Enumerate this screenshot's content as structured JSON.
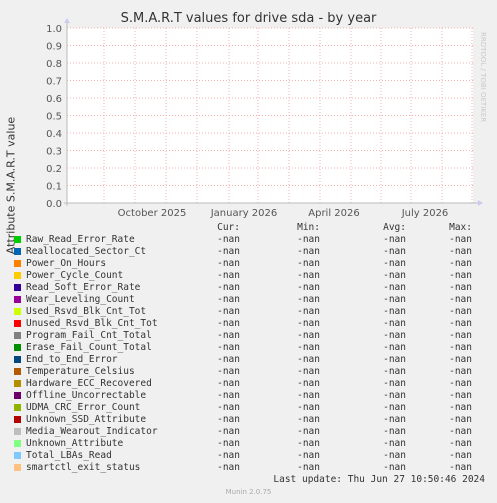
{
  "chart_data": {
    "type": "line",
    "title": "S.M.A.R.T values for drive sda - by year",
    "ylabel": "Attribute S.M.A.R.T value",
    "ylim": [
      0,
      1
    ],
    "yticks": [
      "0.0",
      "0.1",
      "0.2",
      "0.3",
      "0.4",
      "0.5",
      "0.6",
      "0.7",
      "0.8",
      "0.9",
      "1.0"
    ],
    "xticks": [
      "October 2025",
      "January 2026",
      "April 2026",
      "July 2026"
    ],
    "grid": true,
    "series": []
  },
  "side_label": "RRDTOOL / TOBI OETIKER",
  "legend": {
    "headers": {
      "cur": "Cur:",
      "min": "Min:",
      "avg": "Avg:",
      "max": "Max:"
    },
    "rows": [
      {
        "name": "Raw_Read_Error_Rate",
        "color": "#00cc00",
        "cur": "-nan",
        "min": "-nan",
        "avg": "-nan",
        "max": "-nan"
      },
      {
        "name": "Reallocated_Sector_Ct",
        "color": "#0066b3",
        "cur": "-nan",
        "min": "-nan",
        "avg": "-nan",
        "max": "-nan"
      },
      {
        "name": "Power_On_Hours",
        "color": "#ff8000",
        "cur": "-nan",
        "min": "-nan",
        "avg": "-nan",
        "max": "-nan"
      },
      {
        "name": "Power_Cycle_Count",
        "color": "#ffcc00",
        "cur": "-nan",
        "min": "-nan",
        "avg": "-nan",
        "max": "-nan"
      },
      {
        "name": "Read_Soft_Error_Rate",
        "color": "#330099",
        "cur": "-nan",
        "min": "-nan",
        "avg": "-nan",
        "max": "-nan"
      },
      {
        "name": "Wear_Leveling_Count",
        "color": "#990099",
        "cur": "-nan",
        "min": "-nan",
        "avg": "-nan",
        "max": "-nan"
      },
      {
        "name": "Used_Rsvd_Blk_Cnt_Tot",
        "color": "#ccff00",
        "cur": "-nan",
        "min": "-nan",
        "avg": "-nan",
        "max": "-nan"
      },
      {
        "name": "Unused_Rsvd_Blk_Cnt_Tot",
        "color": "#ff0000",
        "cur": "-nan",
        "min": "-nan",
        "avg": "-nan",
        "max": "-nan"
      },
      {
        "name": "Program_Fail_Cnt_Total",
        "color": "#808080",
        "cur": "-nan",
        "min": "-nan",
        "avg": "-nan",
        "max": "-nan"
      },
      {
        "name": "Erase_Fail_Count_Total",
        "color": "#008f00",
        "cur": "-nan",
        "min": "-nan",
        "avg": "-nan",
        "max": "-nan"
      },
      {
        "name": "End_to_End_Error",
        "color": "#00487d",
        "cur": "-nan",
        "min": "-nan",
        "avg": "-nan",
        "max": "-nan"
      },
      {
        "name": "Temperature_Celsius",
        "color": "#b35a00",
        "cur": "-nan",
        "min": "-nan",
        "avg": "-nan",
        "max": "-nan"
      },
      {
        "name": "Hardware_ECC_Recovered",
        "color": "#b38f00",
        "cur": "-nan",
        "min": "-nan",
        "avg": "-nan",
        "max": "-nan"
      },
      {
        "name": "Offline_Uncorrectable",
        "color": "#6b006b",
        "cur": "-nan",
        "min": "-nan",
        "avg": "-nan",
        "max": "-nan"
      },
      {
        "name": "UDMA_CRC_Error_Count",
        "color": "#8fb300",
        "cur": "-nan",
        "min": "-nan",
        "avg": "-nan",
        "max": "-nan"
      },
      {
        "name": "Unknown_SSD_Attribute",
        "color": "#b30000",
        "cur": "-nan",
        "min": "-nan",
        "avg": "-nan",
        "max": "-nan"
      },
      {
        "name": "Media_Wearout_Indicator",
        "color": "#bebebe",
        "cur": "-nan",
        "min": "-nan",
        "avg": "-nan",
        "max": "-nan"
      },
      {
        "name": "Unknown_Attribute",
        "color": "#80ff80",
        "cur": "-nan",
        "min": "-nan",
        "avg": "-nan",
        "max": "-nan"
      },
      {
        "name": "Total_LBAs_Read",
        "color": "#80c9ff",
        "cur": "-nan",
        "min": "-nan",
        "avg": "-nan",
        "max": "-nan"
      },
      {
        "name": "smartctl_exit_status",
        "color": "#ffc080",
        "cur": "-nan",
        "min": "-nan",
        "avg": "-nan",
        "max": "-nan"
      }
    ]
  },
  "last_update": "Last update: Thu Jun 27 10:50:46 2024",
  "footer": "Munin 2.0.75"
}
